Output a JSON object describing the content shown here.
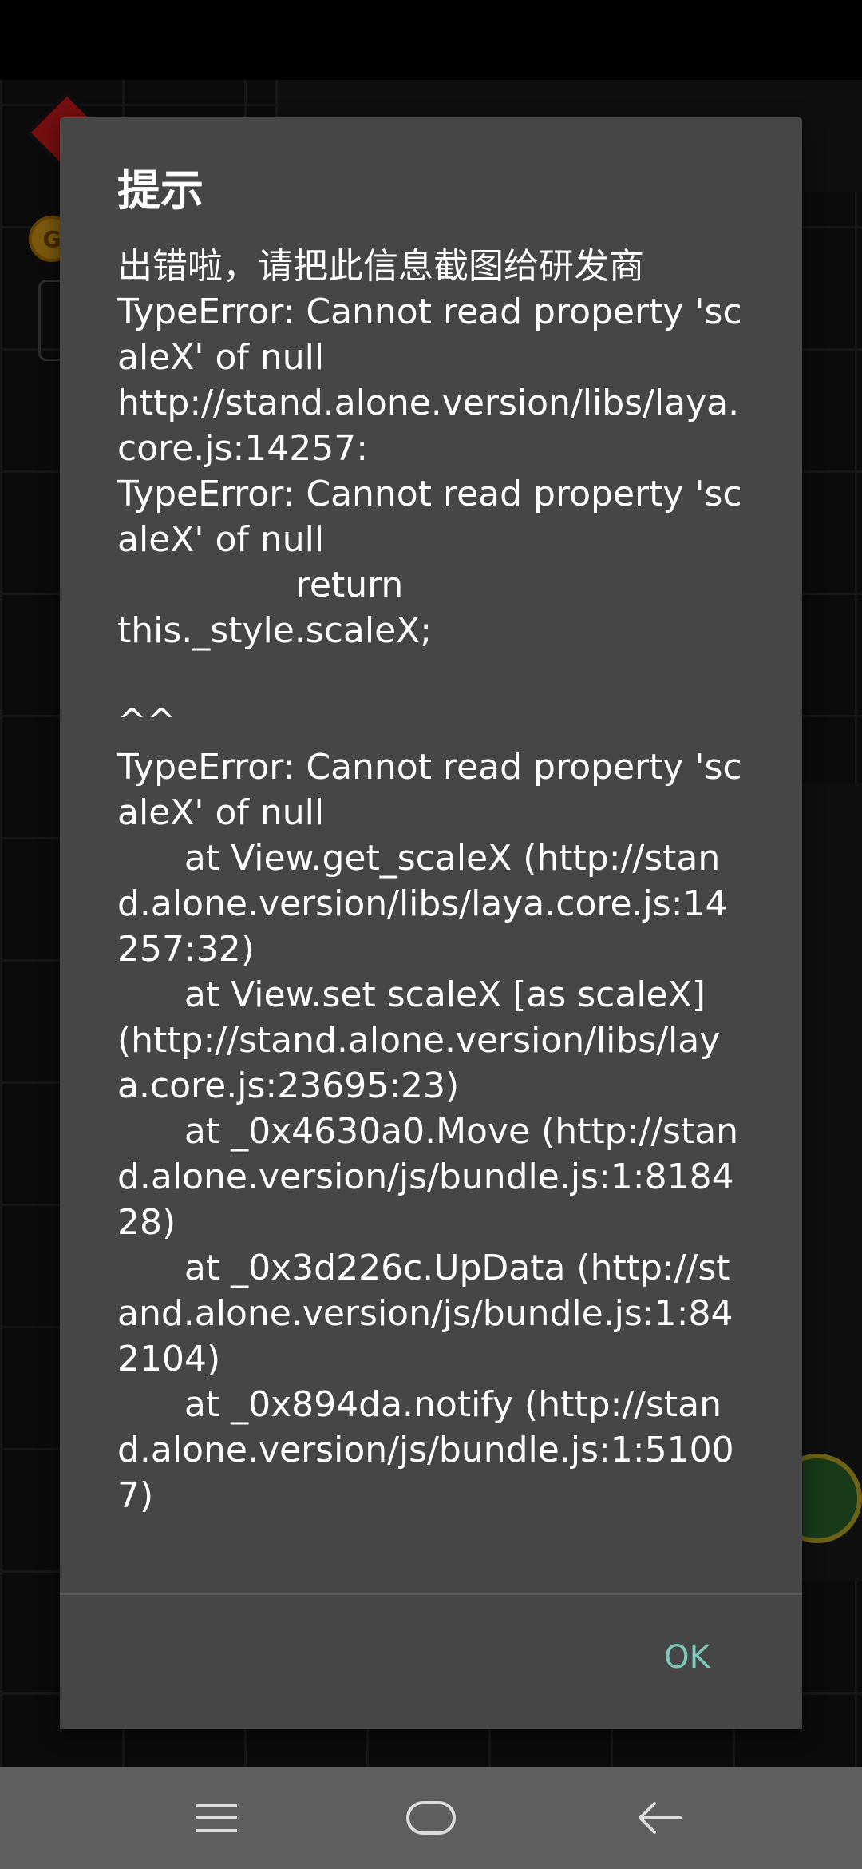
{
  "dialog": {
    "title": "提示",
    "message": "出错啦，请把此信息截图给研发商\nTypeError: Cannot read property 'scaleX' of null\nhttp://stand.alone.version/libs/laya.core.js:14257:\nTypeError: Cannot read property 'scaleX' of null\n                return\nthis._style.scaleX;\n\n^^\nTypeError: Cannot read property 'scaleX' of null\n      at View.get_scaleX (http://stand.alone.version/libs/laya.core.js:14257:32)\n      at View.set scaleX [as scaleX] (http://stand.alone.version/libs/laya.core.js:23695:23)\n      at _0x4630a0.Move (http://stand.alone.version/js/bundle.js:1:818428)\n      at _0x3d226c.UpData (http://stand.alone.version/js/bundle.js:1:842104)\n      at _0x894da.notify (http://stand.alone.version/js/bundle.js:1:51007)",
    "ok_label": "OK"
  },
  "background": {
    "coin_letter": "G"
  },
  "nav_bar": {
    "menu_icon": "menu-icon",
    "home_icon": "home-icon",
    "back_icon": "back-arrow-icon"
  },
  "colors": {
    "dialog_bg": "#464646",
    "accent": "#7fc7b9",
    "nav_bg": "#5e5e5e"
  }
}
